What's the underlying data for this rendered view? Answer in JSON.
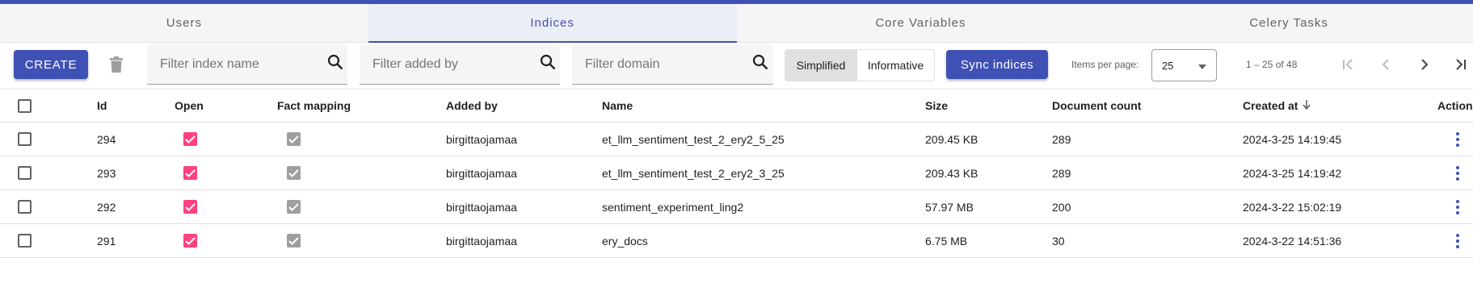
{
  "tabs": [
    {
      "label": "Users",
      "active": false
    },
    {
      "label": "Indices",
      "active": true
    },
    {
      "label": "Core Variables",
      "active": false
    },
    {
      "label": "Celery Tasks",
      "active": false
    }
  ],
  "toolbar": {
    "create_label": "CREATE",
    "filters": {
      "index_name_placeholder": "Filter index name",
      "added_by_placeholder": "Filter added by",
      "domain_placeholder": "Filter domain"
    },
    "view_toggle": {
      "simplified": "Simplified",
      "informative": "Informative",
      "selected": "Simplified"
    },
    "sync_label": "Sync indices",
    "items_per_page_label": "Items per page:",
    "items_per_page_value": "25",
    "range_label": "1 – 25 of 48"
  },
  "table": {
    "columns": {
      "id": "Id",
      "open": "Open",
      "fact_mapping": "Fact mapping",
      "added_by": "Added by",
      "name": "Name",
      "size": "Size",
      "document_count": "Document count",
      "created_at": "Created at",
      "actions": "Actions"
    },
    "sort": {
      "column": "created_at",
      "direction": "desc"
    },
    "rows": [
      {
        "id": "294",
        "open": true,
        "fact_mapping": true,
        "added_by": "birgittaojamaa",
        "name": "et_llm_sentiment_test_2_ery2_5_25",
        "size": "209.45 KB",
        "document_count": "289",
        "created_at": "2024-3-25 14:19:45"
      },
      {
        "id": "293",
        "open": true,
        "fact_mapping": true,
        "added_by": "birgittaojamaa",
        "name": "et_llm_sentiment_test_2_ery2_3_25",
        "size": "209.43 KB",
        "document_count": "289",
        "created_at": "2024-3-25 14:19:42"
      },
      {
        "id": "292",
        "open": true,
        "fact_mapping": true,
        "added_by": "birgittaojamaa",
        "name": "sentiment_experiment_ling2",
        "size": "57.97 MB",
        "document_count": "200",
        "created_at": "2024-3-22 15:02:19"
      },
      {
        "id": "291",
        "open": true,
        "fact_mapping": true,
        "added_by": "birgittaojamaa",
        "name": "ery_docs",
        "size": "6.75 MB",
        "document_count": "30",
        "created_at": "2024-3-22 14:51:36"
      }
    ]
  },
  "colors": {
    "primary": "#3f51b5",
    "accent": "#ff4081",
    "disabled_check": "#9e9e9e"
  }
}
